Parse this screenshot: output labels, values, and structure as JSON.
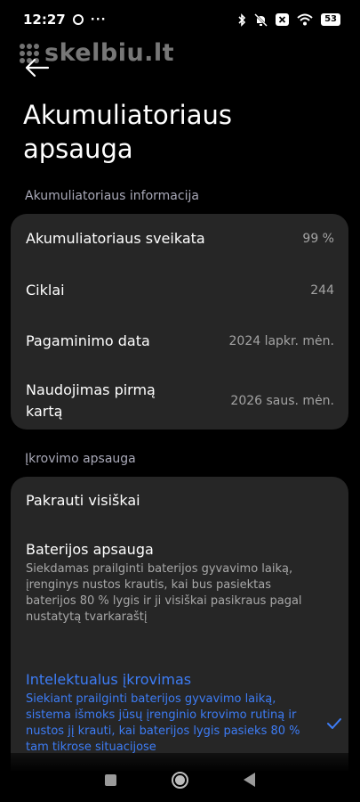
{
  "status_bar": {
    "time": "12:27",
    "more_dots": "···",
    "battery_level": "53",
    "icons": [
      "ring-icon",
      "bluetooth-icon",
      "mute-icon",
      "close-box-icon",
      "wifi-icon",
      "battery-icon"
    ]
  },
  "watermark": {
    "text": "skelbiu.lt"
  },
  "header": {
    "title": "Akumuliatoriaus apsauga"
  },
  "battery_info": {
    "section_label": "Akumuliatoriaus informacija",
    "rows": [
      {
        "label": "Akumuliatoriaus sveikata",
        "value": "99 %"
      },
      {
        "label": "Ciklai",
        "value": "244"
      },
      {
        "label": "Pagaminimo data",
        "value": "2024 lapkr. mėn."
      },
      {
        "label": "Naudojimas pirmą kartą",
        "value": "2026 saus. mėn."
      }
    ]
  },
  "charging_protection": {
    "section_label": "Įkrovimo apsauga",
    "options": [
      {
        "title": "Pakrauti visiškai",
        "description": "",
        "selected": false
      },
      {
        "title": "Baterijos apsauga",
        "description": "Siekdamas prailginti baterijos gyvavimo laiką, įrenginys nustos krautis, kai bus pasiektas baterijos 80 % lygis ir ji visiškai pasikraus pagal nustatytą tvarkaraštį",
        "selected": false
      },
      {
        "title": "Intelektualus įkrovimas",
        "description": "Siekiant prailginti baterijos gyvavimo laiką, sistema išmoks jūsų įrenginio krovimo rutiną ir nustos jį krauti, kai baterijos lygis pasieks 80 % tam tikrose situacijose",
        "selected": true
      }
    ]
  },
  "colors": {
    "accent": "#3d7cf5",
    "card": "#262626",
    "background": "#000000"
  },
  "nav_bar": {
    "icons": [
      "recents-icon",
      "home-icon",
      "back-icon"
    ]
  }
}
